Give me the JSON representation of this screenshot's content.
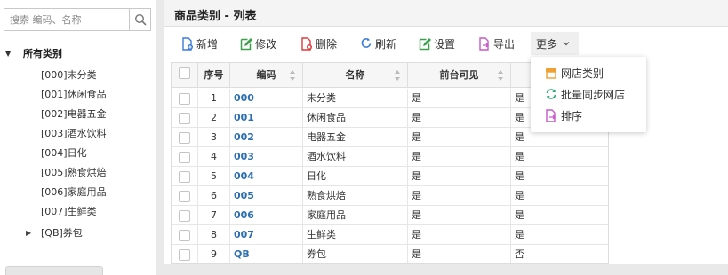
{
  "search": {
    "placeholder": "搜索 编码、名称"
  },
  "tree": {
    "root_label": "所有类别",
    "items": [
      {
        "label": "[000]未分类",
        "expandable": false
      },
      {
        "label": "[001]休闲食品",
        "expandable": false
      },
      {
        "label": "[002]电器五金",
        "expandable": false
      },
      {
        "label": "[003]酒水饮料",
        "expandable": false
      },
      {
        "label": "[004]日化",
        "expandable": false
      },
      {
        "label": "[005]熟食烘焙",
        "expandable": false
      },
      {
        "label": "[006]家庭用品",
        "expandable": false
      },
      {
        "label": "[007]生鲜类",
        "expandable": false
      },
      {
        "label": "[QB]券包",
        "expandable": true
      }
    ]
  },
  "page": {
    "title": "商品类别 - 列表"
  },
  "toolbar": {
    "add": "新增",
    "edit": "修改",
    "delete": "删除",
    "refresh": "刷新",
    "settings": "设置",
    "export": "导出",
    "more": "更多"
  },
  "grid": {
    "headers": {
      "seq": "序号",
      "code": "编码",
      "name": "名称",
      "visible": "前台可见"
    },
    "rows": [
      {
        "seq": "1",
        "code": "000",
        "name": "未分类",
        "visible": "是",
        "extra": "是"
      },
      {
        "seq": "2",
        "code": "001",
        "name": "休闲食品",
        "visible": "是",
        "extra": "是"
      },
      {
        "seq": "3",
        "code": "002",
        "name": "电器五金",
        "visible": "是",
        "extra": "是"
      },
      {
        "seq": "4",
        "code": "003",
        "name": "酒水饮料",
        "visible": "是",
        "extra": "是"
      },
      {
        "seq": "5",
        "code": "004",
        "name": "日化",
        "visible": "是",
        "extra": "是"
      },
      {
        "seq": "6",
        "code": "005",
        "name": "熟食烘焙",
        "visible": "是",
        "extra": "是"
      },
      {
        "seq": "7",
        "code": "006",
        "name": "家庭用品",
        "visible": "是",
        "extra": "是"
      },
      {
        "seq": "8",
        "code": "007",
        "name": "生鲜类",
        "visible": "是",
        "extra": "是"
      },
      {
        "seq": "9",
        "code": "QB",
        "name": "券包",
        "visible": "是",
        "extra": "否"
      }
    ]
  },
  "more_menu": {
    "items": [
      {
        "label": "网店类别",
        "icon": "store-icon"
      },
      {
        "label": "批量同步网店",
        "icon": "sync-icon"
      },
      {
        "label": "排序",
        "icon": "sort-doc-icon"
      }
    ]
  },
  "colors": {
    "accent": "#2c6fb0",
    "add": "#3b7dd8",
    "edit": "#3aa14a",
    "delete": "#e03a3a",
    "export": "#c659c9",
    "sync": "#2aa876",
    "store": "#f0a030"
  }
}
